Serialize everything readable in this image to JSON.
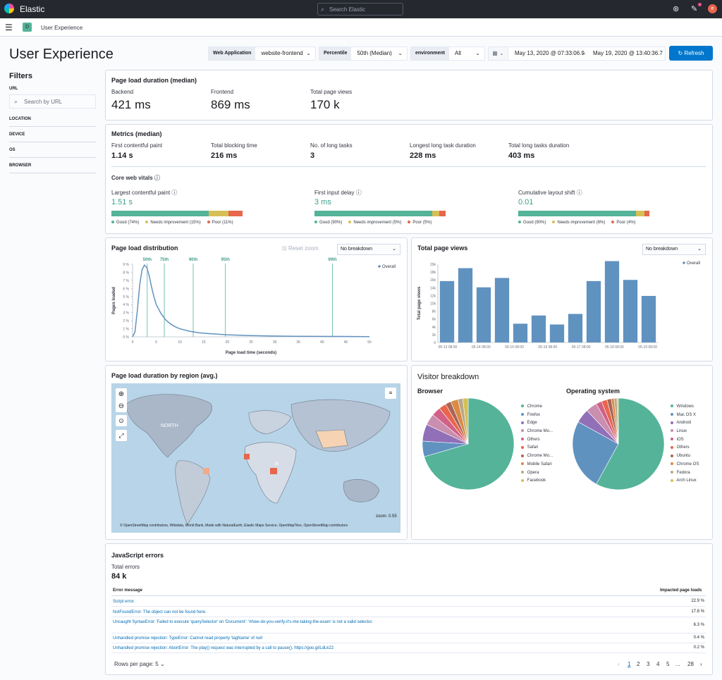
{
  "app": {
    "brand": "Elastic",
    "search_placeholder": "Search Elastic",
    "breadcrumb": "User Experience",
    "space": "D",
    "avatar": "e"
  },
  "page": {
    "title": "User Experience"
  },
  "filters": {
    "web_app_label": "Web Application",
    "web_app_value": "website-frontend",
    "percentile_label": "Percentile",
    "percentile_value": "50th (Median)",
    "env_label": "environment",
    "env_value": "All",
    "date_start": "May 13, 2020 @ 07:33:06.9",
    "date_arrow": "→",
    "date_end": "May 19, 2020 @ 13:40:36.7",
    "refresh": "Refresh"
  },
  "sidebar": {
    "title": "Filters",
    "url_label": "URL",
    "url_placeholder": "Search by URL",
    "items": [
      "LOCATION",
      "DEVICE",
      "OS",
      "BROWSER"
    ]
  },
  "pld": {
    "title": "Page load duration (median)",
    "backend_label": "Backend",
    "backend": "421 ms",
    "frontend_label": "Frontend",
    "frontend": "869 ms",
    "views_label": "Total page views",
    "views": "170 k"
  },
  "metrics": {
    "title": "Metrics (median)",
    "items": [
      {
        "label": "First contentful paint",
        "value": "1.14 s"
      },
      {
        "label": "Total blocking time",
        "value": "216 ms"
      },
      {
        "label": "No. of long tasks",
        "value": "3"
      },
      {
        "label": "Longest long task duration",
        "value": "228 ms"
      },
      {
        "label": "Total long tasks duration",
        "value": "403 ms"
      }
    ]
  },
  "cwv": {
    "title": "Core web vitals",
    "items": [
      {
        "label": "Largest contentful paint",
        "value": "1.51 s",
        "good": 74,
        "ni": 15,
        "poor": 11,
        "legend": [
          "Good (74%)",
          "Needs improvement (15%)",
          "Poor (11%)"
        ]
      },
      {
        "label": "First input delay",
        "value": "3 ms",
        "good": 90,
        "ni": 5,
        "poor": 5,
        "legend": [
          "Good (90%)",
          "Needs improvement (5%)",
          "Poor (5%)"
        ]
      },
      {
        "label": "Cumulative layout shift",
        "value": "0.01",
        "good": 90,
        "ni": 6,
        "poor": 4,
        "legend": [
          "Good (90%)",
          "Needs improvement (6%)",
          "Poor (4%)"
        ]
      }
    ],
    "colors": {
      "good": "#54b399",
      "ni": "#d6bf57",
      "poor": "#e7664c"
    }
  },
  "dist": {
    "title": "Page load distribution",
    "reset": "Reset zoom",
    "breakdown": "No breakdown",
    "ylabel": "Pages loaded",
    "xlabel": "Page load time (seconds)",
    "legend": "Overall"
  },
  "views": {
    "title": "Total page views",
    "breakdown": "No breakdown",
    "ylabel": "Total page views",
    "legend": "Overall"
  },
  "map": {
    "title": "Page load duration by region (avg.)",
    "label_north": "NORTH",
    "label_a": "A",
    "zoom": "zoom: 0.55",
    "attribution": "© OpenStreetMap contributors, Wikidata, World Bank, Made with NaturalEarth, Elastic Maps Service, OpenMapTiles, OpenStreetMap contributors"
  },
  "visitor": {
    "title": "Visitor breakdown",
    "browser_title": "Browser",
    "os_title": "Operating system"
  },
  "errors": {
    "title": "JavaScript errors",
    "total_label": "Total errors",
    "total": "84 k",
    "col_msg": "Error message",
    "col_impact": "Impacted page loads",
    "rows": [
      {
        "msg": "Script error.",
        "pct": "22.9 %"
      },
      {
        "msg": "NotFoundError: The object can not be found here.",
        "pct": "17.8 %"
      },
      {
        "msg": "Uncaught SyntaxError: Failed to execute 'querySelector' on 'Document': '#how-do-you-verify-it's-me-taking-the-exam' is not a valid selector.",
        "pct": "6.3 %"
      },
      {
        "msg": "Unhandled promise rejection: TypeError: Cannot read property 'tagName' of null",
        "pct": "0.4 %"
      },
      {
        "msg": "Unhandled promise rejection: AbortError: The play() request was interrupted by a call to pause(). https://goo.gl/LdLk22",
        "pct": "0.2 %"
      }
    ],
    "rows_per_page": "Rows per page: 5",
    "pages": [
      "1",
      "2",
      "3",
      "4",
      "5",
      "...",
      "28"
    ]
  },
  "chart_data": [
    {
      "type": "line",
      "title": "Page load distribution",
      "xlabel": "Page load time (seconds)",
      "ylabel": "Pages loaded",
      "xlim": [
        0,
        50
      ],
      "ylim": [
        0,
        9
      ],
      "x_ticks": [
        "0",
        "5",
        "10",
        "15",
        "20",
        "25",
        "30",
        "35",
        "40",
        "45",
        "50"
      ],
      "y_ticks": [
        "0 %",
        "1 %",
        "2 %",
        "3 %",
        "4 %",
        "5 %",
        "6 %",
        "7 %",
        "8 %",
        "9 %"
      ],
      "series": [
        {
          "name": "Overall",
          "x": [
            0,
            0.5,
            1,
            1.5,
            2,
            2.5,
            3,
            3.5,
            4,
            4.5,
            5,
            6,
            7,
            8,
            9,
            10,
            12,
            14,
            16,
            18,
            20,
            25,
            30,
            35,
            40,
            45,
            50
          ],
          "y": [
            0,
            0.6,
            3.2,
            6.4,
            8.3,
            8.9,
            8.6,
            7.6,
            6.2,
            5.0,
            4.0,
            2.9,
            2.1,
            1.6,
            1.25,
            1.0,
            0.7,
            0.5,
            0.4,
            0.32,
            0.25,
            0.15,
            0.1,
            0.07,
            0.05,
            0.04,
            0.03
          ]
        }
      ],
      "percentiles": [
        {
          "label": "50th",
          "x": 3.1
        },
        {
          "label": "75th",
          "x": 6.7
        },
        {
          "label": "90th",
          "x": 12.8
        },
        {
          "label": "95th",
          "x": 19.6
        },
        {
          "label": "99th",
          "x": 42.2
        }
      ],
      "color": "#6092c0"
    },
    {
      "type": "bar",
      "title": "Total page views",
      "ylabel": "Total page views",
      "ylim": [
        0,
        20000
      ],
      "y_ticks": [
        "0",
        "2k",
        "4k",
        "6k",
        "8k",
        "10k",
        "12k",
        "14k",
        "16k",
        "18k",
        "20k"
      ],
      "x_ticks": [
        "05-13 08:00",
        "05-14 08:00",
        "05-15 08:00",
        "05-16 08:00",
        "05-17 08:00",
        "05-18 08:00",
        "05-19 08:00"
      ],
      "values": [
        15700,
        19000,
        14100,
        16500,
        4800,
        6900,
        4600,
        7300,
        15700,
        20800,
        16000,
        11900
      ],
      "series": [
        {
          "name": "Overall"
        }
      ],
      "color": "#6092c0"
    },
    {
      "type": "pie",
      "title": "Browser",
      "labels": [
        "Chrome",
        "Firefox",
        "Edge",
        "Chrome Mo...",
        "Others",
        "Safari",
        "Chrome Mo...",
        "Mobile Safari",
        "Opera",
        "Facebook"
      ],
      "values": [
        70.5,
        5.5,
        6,
        4,
        3.2,
        2.6,
        2,
        2.6,
        1.7,
        1.9
      ],
      "colors": [
        "#54b399",
        "#6092c0",
        "#9170b8",
        "#ca8eae",
        "#d36086",
        "#e7664c",
        "#aa6556",
        "#da8b45",
        "#b9a888",
        "#d6bf57"
      ]
    },
    {
      "type": "pie",
      "title": "Operating system",
      "labels": [
        "Windows",
        "Mac OS X",
        "Android",
        "Linux",
        "iOS",
        "Others",
        "Ubuntu",
        "Chrome OS",
        "Fedora",
        "Arch Linux"
      ],
      "values": [
        58,
        25,
        5,
        4,
        2,
        2,
        1.5,
        1,
        1,
        0.5
      ],
      "colors": [
        "#54b399",
        "#6092c0",
        "#9170b8",
        "#ca8eae",
        "#d36086",
        "#e7664c",
        "#aa6556",
        "#da8b45",
        "#b9a888",
        "#d6bf57"
      ]
    }
  ]
}
